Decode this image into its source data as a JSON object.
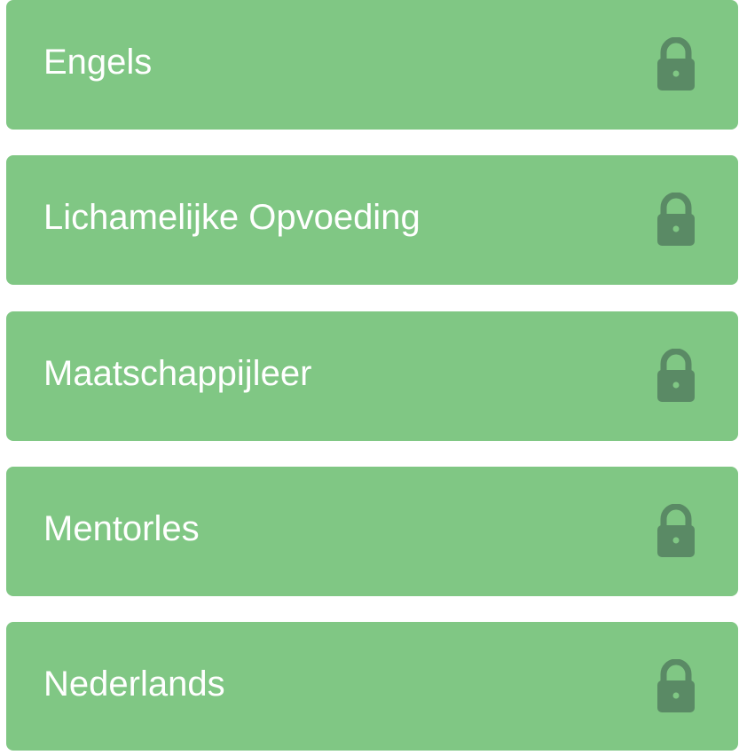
{
  "subjects": [
    {
      "label": "Engels",
      "icon": "lock-icon"
    },
    {
      "label": "Lichamelijke Opvoeding",
      "icon": "lock-icon"
    },
    {
      "label": "Maatschappijleer",
      "icon": "lock-icon"
    },
    {
      "label": "Mentorles",
      "icon": "lock-icon"
    },
    {
      "label": "Nederlands",
      "icon": "lock-icon"
    }
  ],
  "colors": {
    "card_background": "#80c784",
    "label_text": "#ffffff",
    "lock_icon": "#5a8a65",
    "lock_keyhole": "#80c784"
  }
}
